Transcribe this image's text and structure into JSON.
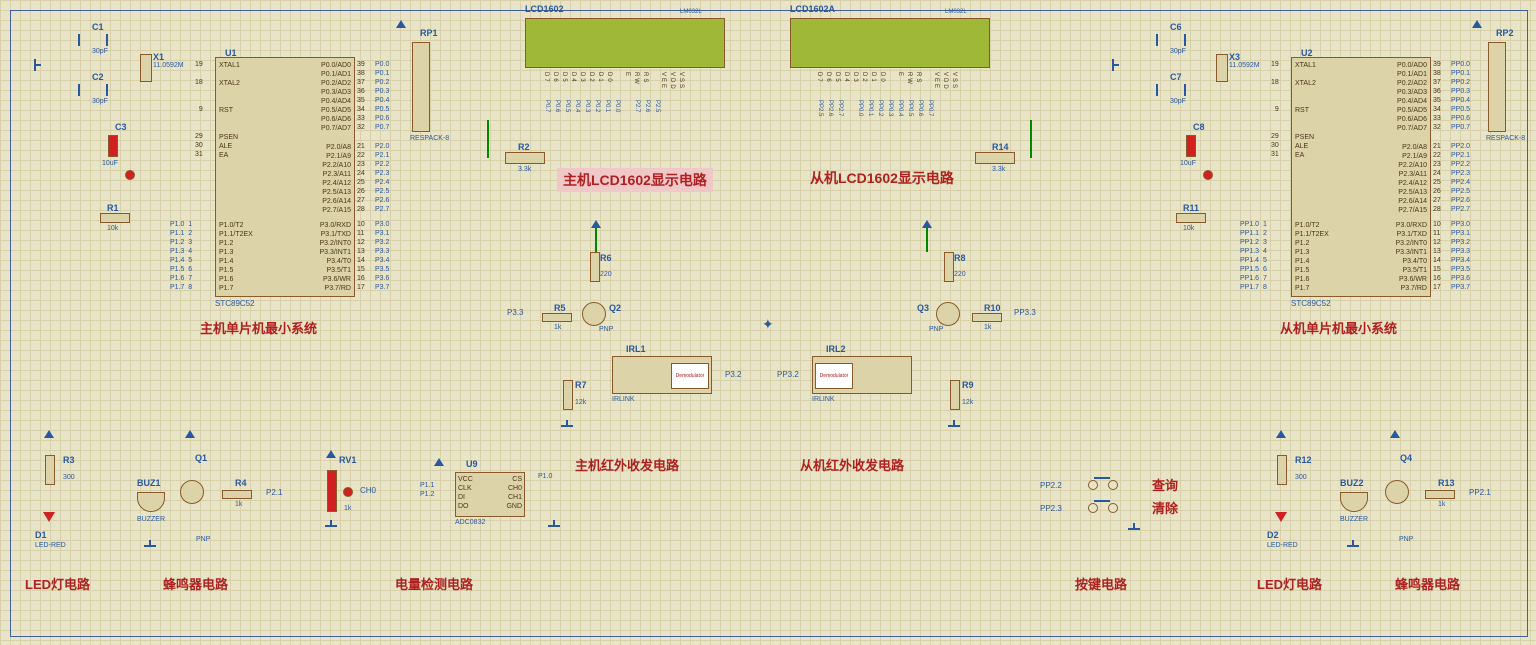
{
  "lcd": {
    "name1": "LCD1602",
    "name2": "LCD1602A",
    "model": "LM032L"
  },
  "master": {
    "mcu": {
      "ref": "U1",
      "part": "STC89C52"
    },
    "crystal": {
      "ref": "X1",
      "val": "11.0592M"
    },
    "c1": {
      "ref": "C1",
      "val": "30pF"
    },
    "c2": {
      "ref": "C2",
      "val": "30pF"
    },
    "c3": {
      "ref": "C3",
      "val": "10uF"
    },
    "r1": {
      "ref": "R1",
      "val": "10k"
    },
    "rp1": {
      "ref": "RP1",
      "part": "RESPACK-8"
    },
    "r2": {
      "ref": "R2",
      "val": "3.3k"
    },
    "r5": {
      "ref": "R5",
      "val": "1k"
    },
    "r6": {
      "ref": "R6",
      "val": "220"
    },
    "r7": {
      "ref": "R7",
      "val": "12k"
    },
    "q2": {
      "ref": "Q2",
      "type": "PNP"
    },
    "irl1": {
      "ref": "IRL1",
      "part": "IRLINK"
    },
    "caption": "主机单片机最小系统",
    "lcd_caption": "主机LCD1602显示电路",
    "ir_caption": "主机红外收发电路"
  },
  "slave": {
    "mcu": {
      "ref": "U2",
      "part": "STC89C52"
    },
    "crystal": {
      "ref": "X3",
      "val": "11.0592M"
    },
    "c6": {
      "ref": "C6",
      "val": "30pF"
    },
    "c7": {
      "ref": "C7",
      "val": "30pF"
    },
    "c8": {
      "ref": "C8",
      "val": "10uF"
    },
    "r11": {
      "ref": "R11",
      "val": "10k"
    },
    "rp2": {
      "ref": "RP2",
      "part": "RESPACK-8"
    },
    "r14": {
      "ref": "R14",
      "val": "3.3k"
    },
    "r9": {
      "ref": "R9",
      "val": "12k"
    },
    "r10": {
      "ref": "R10",
      "val": "1k"
    },
    "r8": {
      "ref": "R8",
      "val": "220"
    },
    "q3": {
      "ref": "Q3",
      "type": "PNP"
    },
    "irl2": {
      "ref": "IRL2",
      "part": "IRLINK"
    },
    "caption": "从机单片机最小系统",
    "lcd_caption": "从机LCD1602显示电路",
    "ir_caption": "从机红外收发电路"
  },
  "led1": {
    "r3": {
      "ref": "R3",
      "val": "300"
    },
    "d1": {
      "ref": "D1",
      "part": "LED-RED"
    },
    "caption": "LED灯电路"
  },
  "buzzer1": {
    "buz": {
      "ref": "BUZ1",
      "part": "BUZZER"
    },
    "q1": {
      "ref": "Q1",
      "type": "PNP"
    },
    "r4": {
      "ref": "R4",
      "val": "1k"
    },
    "net": "P2.1",
    "caption": "蜂鸣器电路"
  },
  "adc": {
    "rv1": "RV1",
    "val": "1k",
    "net1": "CH0",
    "u9": "U9",
    "part": "ADC0832",
    "pins": {
      "vcc": "VCC",
      "clk": "CLK",
      "di": "DI",
      "do": "DO",
      "cs": "CS",
      "ch0": "CH0",
      "ch1": "CH1",
      "gnd": "GND"
    },
    "p11": "P1.1",
    "p12": "P1.2",
    "p10": "P1.0",
    "caption": "电量检测电路"
  },
  "buttons": {
    "b1": "查询",
    "b2": "清除",
    "net1": "PP2.2",
    "net2": "PP2.3",
    "caption": "按键电路"
  },
  "led2": {
    "r12": {
      "ref": "R12",
      "val": "300"
    },
    "d2": {
      "ref": "D2",
      "part": "LED-RED"
    },
    "caption": "LED灯电路"
  },
  "buzzer2": {
    "buz": {
      "ref": "BUZ2",
      "part": "BUZZER"
    },
    "q4": {
      "ref": "Q4",
      "type": "PNP"
    },
    "r13": {
      "ref": "R13",
      "val": "1k"
    },
    "net": "PP2.1",
    "caption": "蜂鸣器电路"
  },
  "nets": {
    "p33": "P3.3",
    "p32": "P3.2",
    "pp33": "PP3.3",
    "pp32": "PP3.2"
  },
  "mcu_pins": {
    "xtal1": "XTAL1",
    "xtal2": "XTAL2",
    "rst": "RST",
    "psen": "PSEN",
    "ale": "ALE",
    "ea": "EA",
    "left_nums": "19\n\n18\n\n\n9\n\n\n29\n30\n31",
    "p0": "P0.0/AD0\nP0.1/AD1\nP0.2/AD2\nP0.3/AD3\nP0.4/AD4\nP0.5/AD5\nP0.6/AD6\nP0.7/AD7",
    "p0_nums": "39\n38\n37\n36\n35\n34\n33\n32",
    "p0_nets_m": "P0.0\nP0.1\nP0.2\nP0.3\nP0.4\nP0.5\nP0.6\nP0.7",
    "p0_nets_s": "PP0.0\nPP0.1\nPP0.2\nPP0.3\nPP0.4\nPP0.5\nPP0.6\nPP0.7",
    "p2": "P2.0/A8\nP2.1/A9\nP2.2/A10\nP2.3/A11\nP2.4/A12\nP2.5/A13\nP2.6/A14\nP2.7/A15",
    "p2_nums": "21\n22\n23\n24\n25\n26\n27\n28",
    "p2_nets_m": "P2.0\nP2.1\nP2.2\nP2.3\nP2.4\nP2.5\nP2.6\nP2.7",
    "p2_nets_s": "PP2.0\nPP2.1\nPP2.2\nPP2.3\nPP2.4\nPP2.5\nPP2.6\nPP2.7",
    "p1_l": "P1.0/T2\nP1.1/T2EX\nP1.2\nP1.3\nP1.4\nP1.5\nP1.6\nP1.7",
    "p1_nums": "1\n2\n3\n4\n5\n6\n7\n8",
    "p1_nets_m": "P1.0  1\nP1.1  2\nP1.2  3\nP1.3  4\nP1.4  5\nP1.5  6\nP1.6  7\nP1.7  8",
    "p1_nets_s": "PP1.0  1\nPP1.1  2\nPP1.2  3\nPP1.3  4\nPP1.4  5\nPP1.5  6\nPP1.6  7\nPP1.7  8",
    "p3": "P3.0/RXD\nP3.1/TXD\nP3.2/INT0\nP3.3/INT1\nP3.4/T0\nP3.5/T1\nP3.6/WR\nP3.7/RD",
    "p3_nums": "10\n11\n12\n13\n14\n15\n16\n17",
    "p3_nets_m": "P3.0\nP3.1\nP3.2\nP3.3\nP3.4\nP3.5\nP3.6\nP3.7",
    "p3_nets_s": "PP3.0\nPP3.1\nPP3.2\nPP3.3\nPP3.4\nPP3.5\nPP3.6\nPP3.7"
  },
  "lcd_pins": "VSS\nVDD\nVEE\n\nRS\nRW\nE\n\nD0\nD1\nD2\nD3\nD4\nD5\nD6\nD7",
  "lcd_nets_m": "\n\n\n\nP2.5\nP2.6\nP2.7\n\nP0.0\nP0.1\nP0.2\nP0.3\nP0.4\nP0.5\nP0.6\nP0.7",
  "lcd_nets_s": "PP0.7\nPP0.6\nPP0.5\nPP0.4\nPP0.3\nPP0.2\nPP0.1\nPP0.0\n\nPP2.7\nPP2.6\nPP2.5"
}
